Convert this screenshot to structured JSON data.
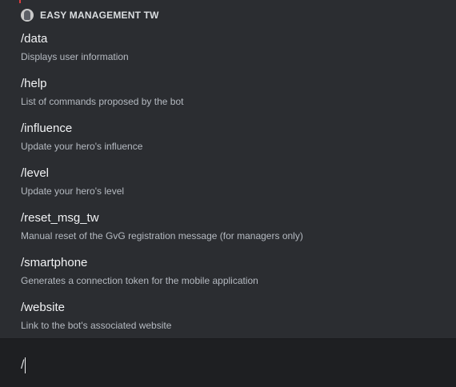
{
  "popup": {
    "bot_name": "EASY MANAGEMENT TW",
    "commands": [
      {
        "name": "/data",
        "description": "Displays user information"
      },
      {
        "name": "/help",
        "description": "List of commands proposed by the bot"
      },
      {
        "name": "/influence",
        "description": "Update your hero's influence"
      },
      {
        "name": "/level",
        "description": "Update your hero's level"
      },
      {
        "name": "/reset_msg_tw",
        "description": "Manual reset of the GvG registration message (for managers only)"
      },
      {
        "name": "/smartphone",
        "description": "Generates a connection token for the mobile application"
      },
      {
        "name": "/website",
        "description": "Link to the bot's associated website"
      }
    ]
  },
  "composer": {
    "value": "/"
  },
  "colors": {
    "popup_background": "#2b2d31",
    "app_background": "#1e1f22",
    "command_name": "#f2f3f5",
    "command_description": "#b5bac1"
  }
}
